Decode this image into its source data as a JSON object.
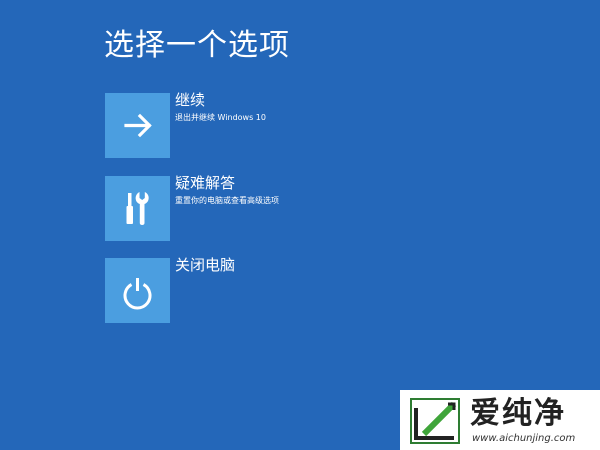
{
  "screen": {
    "title": "选择一个选项",
    "background_color": "#2467b9",
    "tile_color": "#4b9ee0"
  },
  "options": [
    {
      "label": "继续",
      "description": "退出并继续 Windows 10",
      "icon": "arrow-right-icon"
    },
    {
      "label": "疑难解答",
      "description": "重置你的电脑或查看高级选项",
      "icon": "tools-icon"
    },
    {
      "label": "关闭电脑",
      "description": "",
      "icon": "power-icon"
    }
  ],
  "watermark": {
    "name": "爱纯净",
    "url": "www.aichunjing.com"
  }
}
